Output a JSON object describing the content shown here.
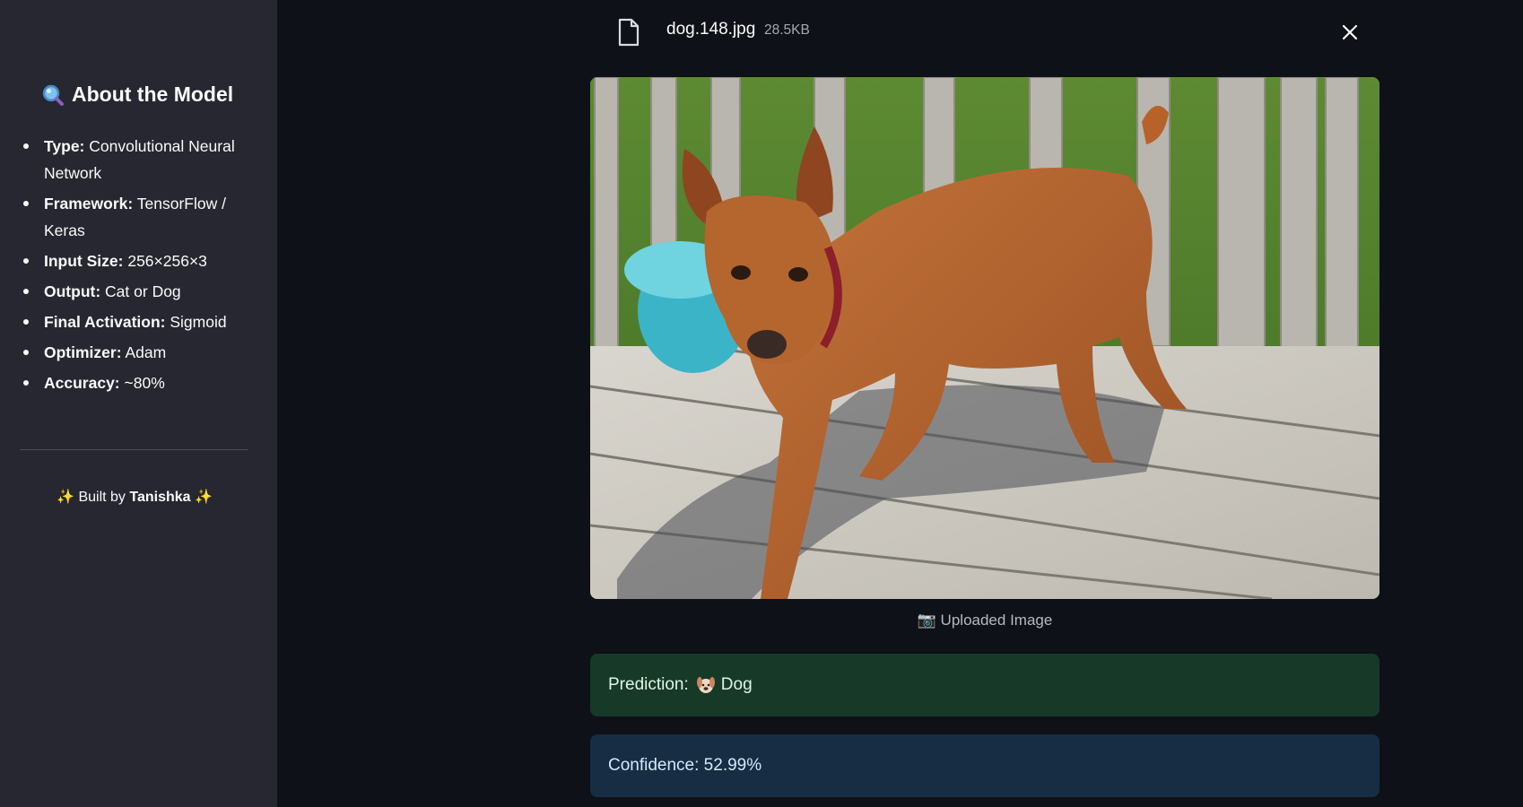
{
  "sidebar": {
    "title": "About the Model",
    "title_icon": "magnifier-icon",
    "items": [
      {
        "key": "Type:",
        "value": "Convolutional Neural Network"
      },
      {
        "key": "Framework:",
        "value": "TensorFlow / Keras"
      },
      {
        "key": "Input Size:",
        "value": "256×256×3"
      },
      {
        "key": "Output:",
        "value": "Cat or Dog"
      },
      {
        "key": "Final Activation:",
        "value": "Sigmoid"
      },
      {
        "key": "Optimizer:",
        "value": "Adam"
      },
      {
        "key": "Accuracy:",
        "value": "~80%"
      }
    ],
    "footer": {
      "prefix": "✨ Built by",
      "author": "Tanishka",
      "suffix": "✨"
    }
  },
  "upload": {
    "file_name": "dog.148.jpg",
    "file_size": "28.5KB",
    "file_icon": "file-icon",
    "close_icon": "close-icon"
  },
  "image": {
    "caption": "📷 Uploaded Image"
  },
  "result": {
    "prediction_label": "Prediction:",
    "prediction_value": "Dog",
    "prediction_icon": "dog-face-icon",
    "confidence_text": "Confidence: 52.99%"
  },
  "colors": {
    "sidebar_bg": "#262730",
    "main_bg": "#0e1117",
    "success_bg": "#173928",
    "info_bg": "#172d43"
  }
}
